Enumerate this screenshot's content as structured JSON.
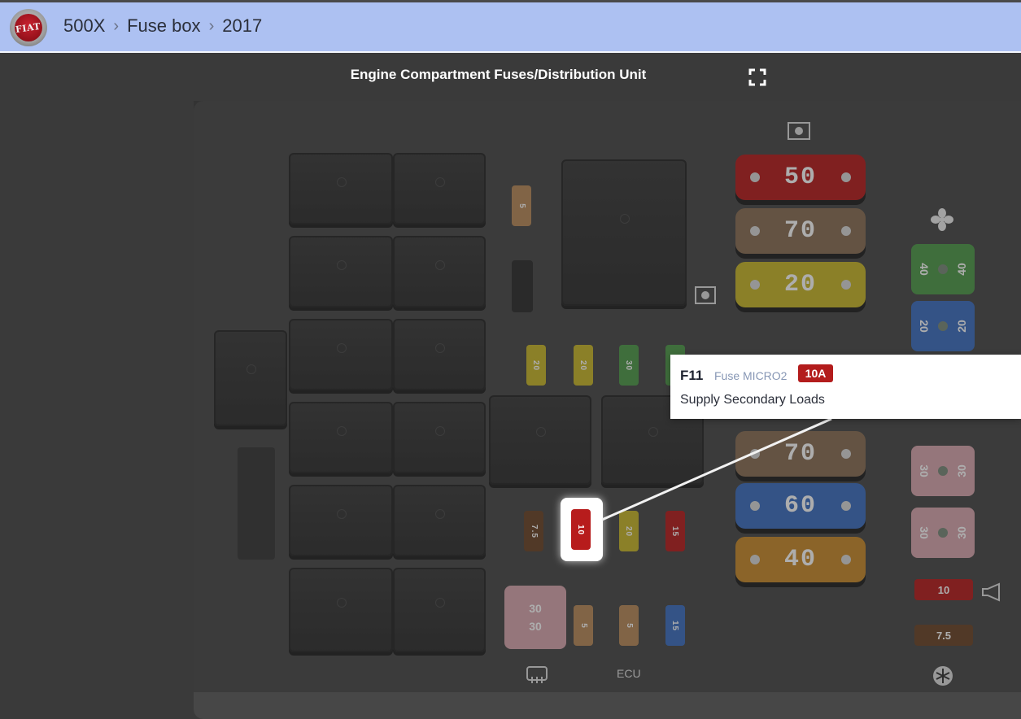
{
  "header": {
    "brand": "FIAT",
    "breadcrumb": [
      "500X",
      "Fuse box",
      "2017"
    ]
  },
  "page": {
    "title": "Engine Compartment Fuses/Distribution Unit"
  },
  "diagram": {
    "mini_fuses_row1": [
      "20",
      "20",
      "30",
      ""
    ],
    "mini_fuses_row2": [
      "7.5",
      "10",
      "20",
      "15"
    ],
    "mini_fuses_row3": [
      "5",
      "5",
      "15"
    ],
    "mini_fuse_top": "5",
    "maxi_fuses_top": [
      "50",
      "70",
      "20"
    ],
    "maxi_fuses_bottom": [
      "70",
      "60",
      "40"
    ],
    "square_fuses_right": [
      [
        "40",
        "40"
      ],
      [
        "20",
        "20"
      ],
      [
        "30",
        "30"
      ],
      [
        "30",
        "30"
      ]
    ],
    "square_fuse_bottom": [
      "30",
      "30"
    ],
    "flat_fuses": [
      "10",
      "7.5"
    ],
    "ecu_label": "ECU",
    "colors": {
      "red": "#b71c1c",
      "tan": "#b98a5a",
      "yellow": "#c9b629",
      "green": "#4e9a49",
      "blue": "#3d6fc0",
      "brown": "#6b4528",
      "pink": "#d8a6ae"
    }
  },
  "tooltip": {
    "id": "F11",
    "type": "Fuse MICRO2",
    "amperage": "10A",
    "description": "Supply Secondary Loads"
  }
}
